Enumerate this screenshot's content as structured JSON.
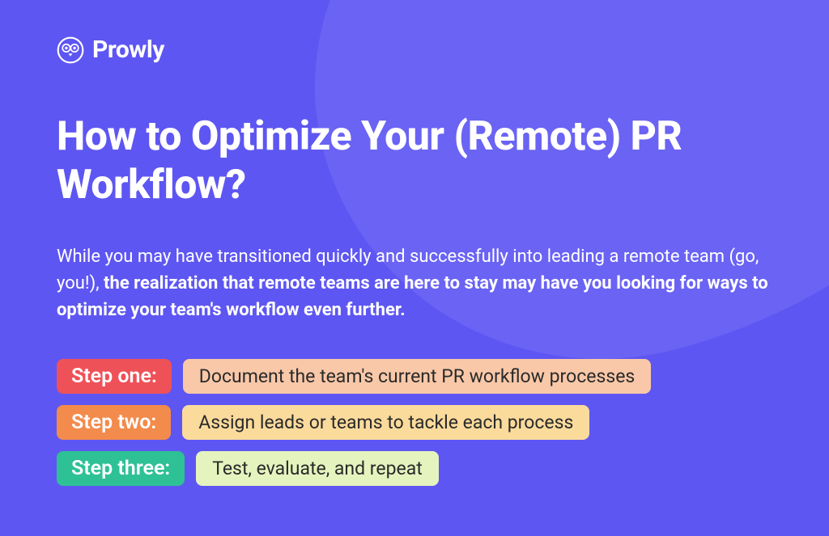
{
  "brand": {
    "name": "Prowly"
  },
  "title": "How to Optimize Your (Remote) PR Workflow?",
  "intro": {
    "normal": "While you may have transitioned quickly and successfully into leading a remote team (go, you!), ",
    "bold": "the realization that remote teams are here to stay may have you looking for ways to optimize your team's workflow even further."
  },
  "steps": [
    {
      "label": "Step one:",
      "desc": "Document the team's current PR workflow processes"
    },
    {
      "label": "Step two:",
      "desc": "Assign leads or teams to tackle each process"
    },
    {
      "label": "Step three:",
      "desc": "Test, evaluate, and repeat"
    }
  ]
}
